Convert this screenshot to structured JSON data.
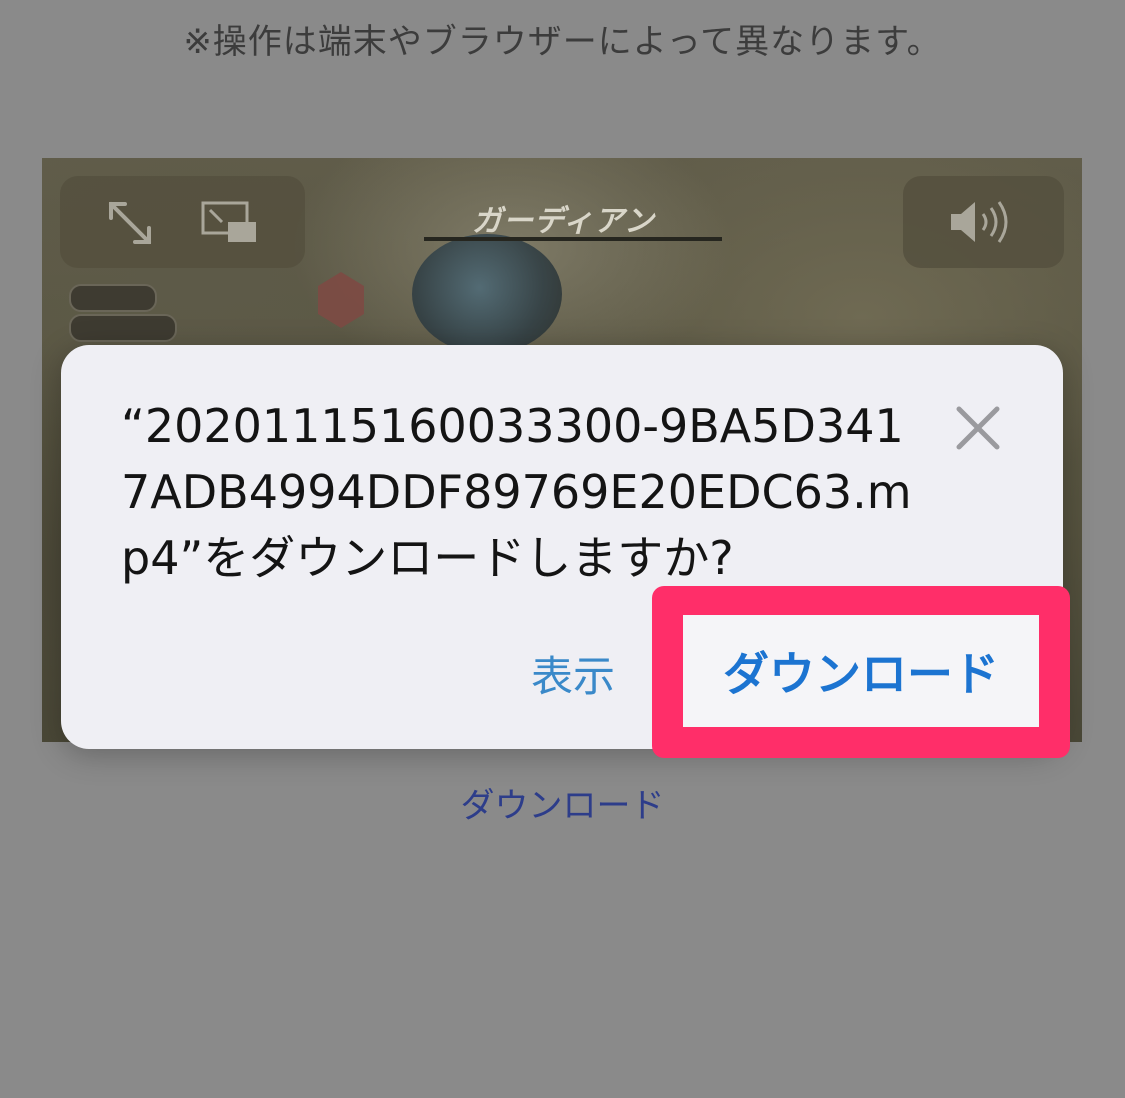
{
  "notice": "※操作は端末やブラウザーによって異なります。",
  "video": {
    "title_text": "ガーディアン",
    "controls": {
      "fullscreen_icon": "expand-arrows-icon",
      "pip_icon": "picture-in-picture-icon",
      "volume_icon": "speaker-volume-icon"
    }
  },
  "dialog": {
    "message": "“20201115160033300-9BA5D3417ADB4994DDF89769E20EDC63.mp4”をダウンロードしますか?",
    "close_icon": "close-x-icon",
    "show_label": "表示",
    "download_label": "ダウンロード"
  },
  "download_link": "ダウンロード",
  "colors": {
    "highlight": "#ff2e69",
    "link_blue": "#1c74d1",
    "dialog_bg": "#efeff4",
    "page_bg": "#8a8a8a"
  }
}
